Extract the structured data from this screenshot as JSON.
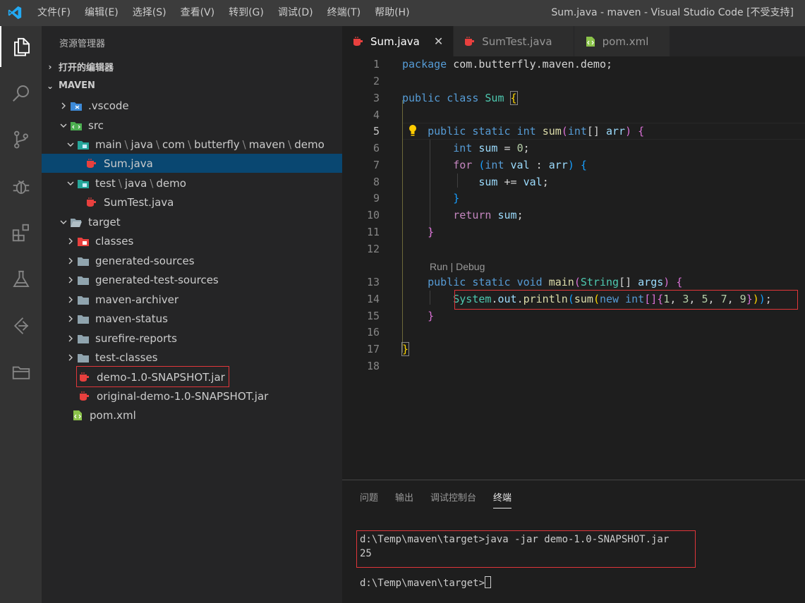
{
  "window": {
    "title": "Sum.java - maven - Visual Studio Code [不受支持]",
    "menu": [
      "文件(F)",
      "编辑(E)",
      "选择(S)",
      "查看(V)",
      "转到(G)",
      "调试(D)",
      "终端(T)",
      "帮助(H)"
    ]
  },
  "activity_bar": {
    "items": [
      "explorer-icon",
      "search-icon",
      "source-control-icon",
      "debug-icon",
      "extensions-icon",
      "test-icon",
      "remote-icon",
      "folder-icon"
    ]
  },
  "explorer": {
    "title": "资源管理器",
    "open_editors": "打开的编辑器",
    "project": "MAVEN",
    "tree": {
      "vscode": ".vscode",
      "src": "src",
      "main_path": [
        "main",
        "java",
        "com",
        "butterfly",
        "maven",
        "demo"
      ],
      "sum_java": "Sum.java",
      "test_path": [
        "test",
        "java",
        "demo"
      ],
      "sumtest_java": "SumTest.java",
      "target": "target",
      "classes": "classes",
      "generated_sources": "generated-sources",
      "generated_test_sources": "generated-test-sources",
      "maven_archiver": "maven-archiver",
      "maven_status": "maven-status",
      "surefire_reports": "surefire-reports",
      "test_classes": "test-classes",
      "demo_jar": "demo-1.0-SNAPSHOT.jar",
      "original_jar": "original-demo-1.0-SNAPSHOT.jar",
      "pom": "pom.xml"
    }
  },
  "tabs": [
    {
      "label": "Sum.java",
      "close": "✕"
    },
    {
      "label": "SumTest.java"
    },
    {
      "label": "pom.xml"
    }
  ],
  "editor": {
    "line_numbers": [
      "1",
      "2",
      "3",
      "4",
      "5",
      "6",
      "7",
      "8",
      "9",
      "10",
      "11",
      "12",
      "13",
      "14",
      "15",
      "16",
      "17",
      "18"
    ],
    "codelens": "Run | Debug"
  },
  "panel": {
    "tabs": [
      "问题",
      "输出",
      "调试控制台",
      "终端"
    ],
    "terminal": {
      "command": "d:\\Temp\\maven\\target>java -jar demo-1.0-SNAPSHOT.jar",
      "output": "25",
      "prompt": "d:\\Temp\\maven\\target>"
    }
  },
  "colors": {
    "accent": "#007acc",
    "selection": "#094771",
    "highlight_box": "#e0363a",
    "java_icon": "#e8403e"
  }
}
